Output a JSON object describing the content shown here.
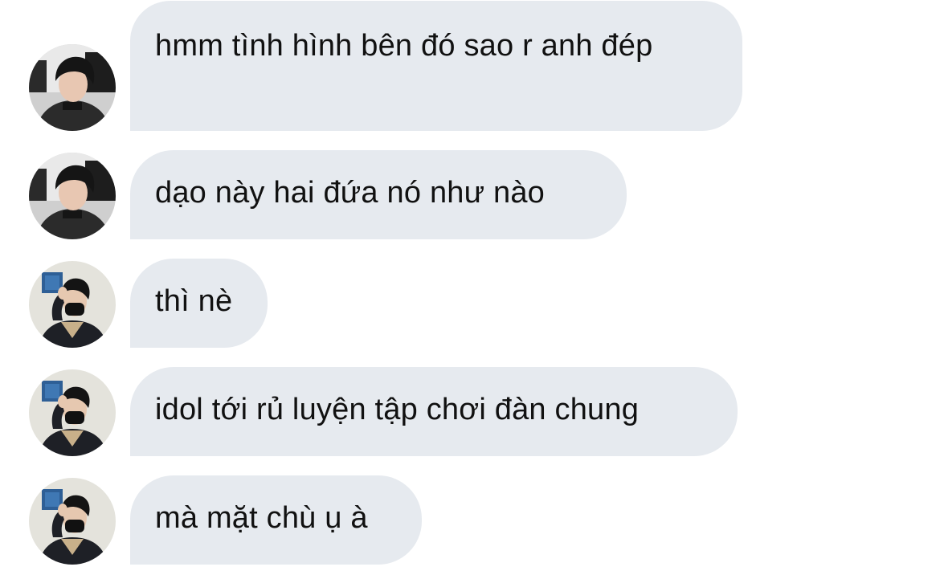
{
  "conversation": {
    "messages": [
      {
        "sender": "avatar-dark-hair",
        "text": "hmm tình hình bên đó sao r anh đép"
      },
      {
        "sender": "avatar-dark-hair",
        "text": "dạo này hai đứa nó như nào"
      },
      {
        "sender": "avatar-masked",
        "text": "thì nè"
      },
      {
        "sender": "avatar-masked",
        "text": "idol tới rủ luyện tập chơi đàn chung"
      },
      {
        "sender": "avatar-masked",
        "text": "mà mặt chù ụ à"
      }
    ]
  },
  "colors": {
    "bubble_background": "#e6eaef",
    "text": "#111111",
    "page_background": "#ffffff"
  }
}
